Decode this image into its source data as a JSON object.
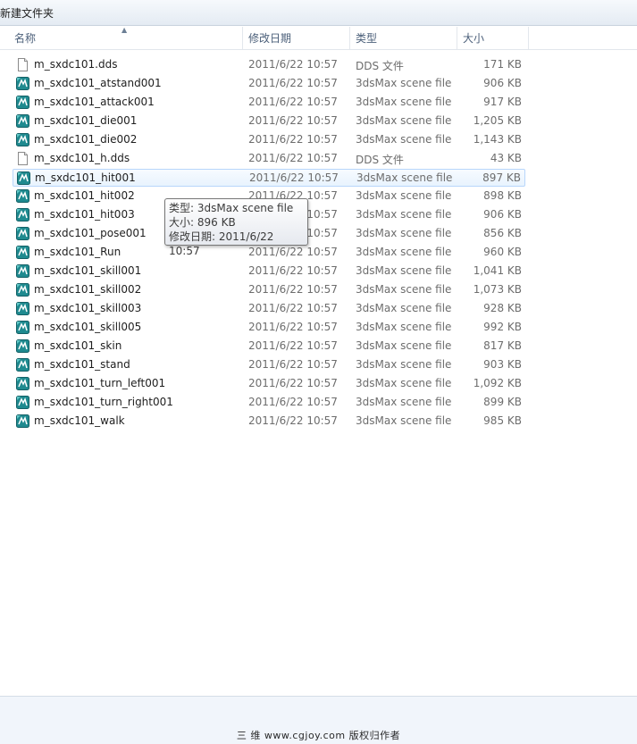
{
  "window": {
    "title": "新建文件夹"
  },
  "columns": {
    "name": "名称",
    "date": "修改日期",
    "type": "类型",
    "size": "大小"
  },
  "colors": {
    "hover_bg": "#e8f3fe",
    "hover_border": "#b8d6fb",
    "max_icon": "#1f8a8f"
  },
  "files": [
    {
      "name": "m_sxdc101.dds",
      "date": "2011/6/22 10:57",
      "type": "DDS 文件",
      "size": "171 KB",
      "icon": "dds-file-icon"
    },
    {
      "name": "m_sxdc101_atstand001",
      "date": "2011/6/22 10:57",
      "type": "3dsMax scene file",
      "size": "906 KB",
      "icon": "3dsmax-file-icon"
    },
    {
      "name": "m_sxdc101_attack001",
      "date": "2011/6/22 10:57",
      "type": "3dsMax scene file",
      "size": "917 KB",
      "icon": "3dsmax-file-icon"
    },
    {
      "name": "m_sxdc101_die001",
      "date": "2011/6/22 10:57",
      "type": "3dsMax scene file",
      "size": "1,205 KB",
      "icon": "3dsmax-file-icon"
    },
    {
      "name": "m_sxdc101_die002",
      "date": "2011/6/22 10:57",
      "type": "3dsMax scene file",
      "size": "1,143 KB",
      "icon": "3dsmax-file-icon"
    },
    {
      "name": "m_sxdc101_h.dds",
      "date": "2011/6/22 10:57",
      "type": "DDS 文件",
      "size": "43 KB",
      "icon": "dds-file-icon"
    },
    {
      "name": "m_sxdc101_hit001",
      "date": "2011/6/22 10:57",
      "type": "3dsMax scene file",
      "size": "897 KB",
      "icon": "3dsmax-file-icon"
    },
    {
      "name": "m_sxdc101_hit002",
      "date": "2011/6/22 10:57",
      "type": "3dsMax scene file",
      "size": "898 KB",
      "icon": "3dsmax-file-icon"
    },
    {
      "name": "m_sxdc101_hit003",
      "date": "2011/6/22 10:57",
      "type": "3dsMax scene file",
      "size": "906 KB",
      "icon": "3dsmax-file-icon"
    },
    {
      "name": "m_sxdc101_pose001",
      "date": "2011/6/22 10:57",
      "type": "3dsMax scene file",
      "size": "856 KB",
      "icon": "3dsmax-file-icon"
    },
    {
      "name": "m_sxdc101_Run",
      "date": "2011/6/22 10:57",
      "type": "3dsMax scene file",
      "size": "960 KB",
      "icon": "3dsmax-file-icon"
    },
    {
      "name": "m_sxdc101_skill001",
      "date": "2011/6/22 10:57",
      "type": "3dsMax scene file",
      "size": "1,041 KB",
      "icon": "3dsmax-file-icon"
    },
    {
      "name": "m_sxdc101_skill002",
      "date": "2011/6/22 10:57",
      "type": "3dsMax scene file",
      "size": "1,073 KB",
      "icon": "3dsmax-file-icon"
    },
    {
      "name": "m_sxdc101_skill003",
      "date": "2011/6/22 10:57",
      "type": "3dsMax scene file",
      "size": "928 KB",
      "icon": "3dsmax-file-icon"
    },
    {
      "name": "m_sxdc101_skill005",
      "date": "2011/6/22 10:57",
      "type": "3dsMax scene file",
      "size": "992 KB",
      "icon": "3dsmax-file-icon"
    },
    {
      "name": "m_sxdc101_skin",
      "date": "2011/6/22 10:57",
      "type": "3dsMax scene file",
      "size": "817 KB",
      "icon": "3dsmax-file-icon"
    },
    {
      "name": "m_sxdc101_stand",
      "date": "2011/6/22 10:57",
      "type": "3dsMax scene file",
      "size": "903 KB",
      "icon": "3dsmax-file-icon"
    },
    {
      "name": "m_sxdc101_turn_left001",
      "date": "2011/6/22 10:57",
      "type": "3dsMax scene file",
      "size": "1,092 KB",
      "icon": "3dsmax-file-icon"
    },
    {
      "name": "m_sxdc101_turn_right001",
      "date": "2011/6/22 10:57",
      "type": "3dsMax scene file",
      "size": "899 KB",
      "icon": "3dsmax-file-icon"
    },
    {
      "name": "m_sxdc101_walk",
      "date": "2011/6/22 10:57",
      "type": "3dsMax scene file",
      "size": "985 KB",
      "icon": "3dsmax-file-icon"
    }
  ],
  "hovered_index": 6,
  "tooltip": {
    "type_line": "类型: 3dsMax scene file",
    "size_line": "大小: 896 KB",
    "date_line": "修改日期: 2011/6/22 10:57"
  },
  "watermark": "三 维 www.cgjoy.com 版权归作者"
}
